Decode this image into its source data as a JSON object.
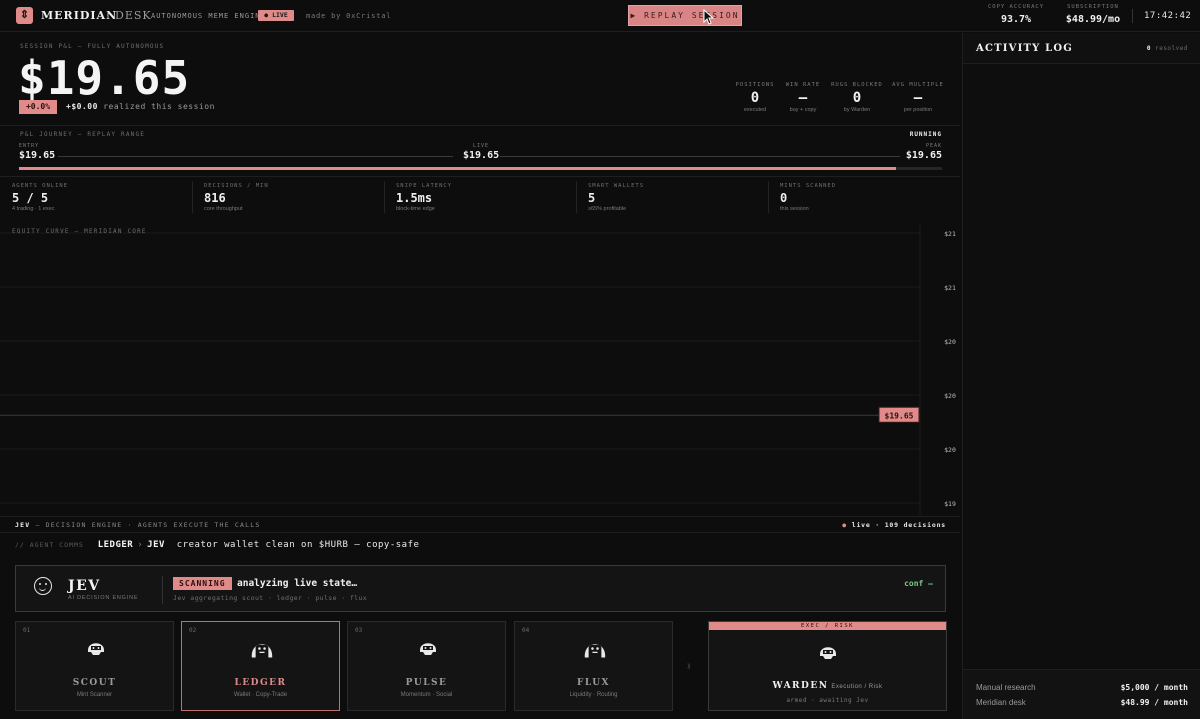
{
  "header": {
    "logo_glyph": "⇕",
    "brand": "MERIDIAN",
    "brand_sub": "· DESK",
    "tagline": "AUTONOMOUS MEME ENGINE",
    "live_label": "● LIVE",
    "made_by": "made by 0xCristal",
    "replay_button": "▶ REPLAY SESSION",
    "copy_accuracy_label": "COPY ACCURACY",
    "copy_accuracy": "93.7%",
    "subscription_label": "SUBSCRIPTION",
    "subscription": "$48.99/mo",
    "clock": "17:42:42"
  },
  "pnl": {
    "label": "SESSION P&L — FULLY AUTONOMOUS",
    "value": "$19.65",
    "pct": "+0.0%",
    "realized_amount": "+$0.00",
    "realized_text": "realized this session",
    "kpis": [
      {
        "label": "POSITIONS",
        "value": "0",
        "sub": "executed"
      },
      {
        "label": "WIN RATE",
        "value": "—",
        "sub": "buy + copy"
      },
      {
        "label": "RUGS BLOCKED",
        "value": "0",
        "sub": "by Warden"
      },
      {
        "label": "AVG MULTIPLE",
        "value": "—",
        "sub": "per position"
      }
    ]
  },
  "journey": {
    "label": "P&L JOURNEY — REPLAY RANGE",
    "status": "RUNNING",
    "entry_label": "ENTRY",
    "entry": "$19.65",
    "live_label": "LIVE",
    "live": "$19.65",
    "peak_label": "PEAK",
    "peak": "$19.65",
    "progress": 0.95
  },
  "stats": [
    {
      "label": "AGENTS ONLINE",
      "value": "5 / 5",
      "sub": "4 trading · 1 exec"
    },
    {
      "label": "DECISIONS / MIN",
      "value": "816",
      "sub": "core throughput"
    },
    {
      "label": "SNIPE LATENCY",
      "value": "1.5ms",
      "sub": "block-time edge"
    },
    {
      "label": "SMART WALLETS",
      "value": "5",
      "sub": "≥65% profitable"
    },
    {
      "label": "MINTS SCANNED",
      "value": "0",
      "sub": "this session"
    }
  ],
  "chart_data": {
    "type": "line",
    "title": "EQUITY CURVE — MERIDIAN CORE",
    "y_ticks": [
      "$21",
      "$21",
      "$20",
      "$20",
      "$20",
      "$19"
    ],
    "current_value_label": "$19.65",
    "current_value": 19.65,
    "ylim": [
      19,
      21
    ],
    "grid": true,
    "series": []
  },
  "engine": {
    "name": "JEV",
    "title_rest": " — DECISION ENGINE · AGENTS EXECUTE THE CALLS",
    "live_dot": "●",
    "live_text": " live · 109 decisions"
  },
  "comms": {
    "label": "// AGENT COMMS",
    "from": "LEDGER",
    "arrow": "›",
    "to": "JEV",
    "message": "creator wallet clean on $HURB — copy-safe"
  },
  "jev": {
    "name": "JEV",
    "role": "AI DECISION ENGINE",
    "status": "SCANNING",
    "message": "analyzing live state…",
    "detail": "Jev aggregating scout · ledger · pulse · flux",
    "conf": "conf —"
  },
  "agents": [
    {
      "num": "01",
      "name": "SCOUT",
      "role": "Mint Scanner",
      "icon": "helmet-avatar-icon"
    },
    {
      "num": "02",
      "name": "LEDGER",
      "role": "Wallet · Copy-Trade",
      "icon": "longhair-avatar-icon"
    },
    {
      "num": "03",
      "name": "PULSE",
      "role": "Momentum · Social",
      "icon": "helmet-avatar-icon"
    },
    {
      "num": "04",
      "name": "FLUX",
      "role": "Liquidity · Routing",
      "icon": "longhair-avatar-icon"
    }
  ],
  "arrow_sep": "⟫",
  "warden": {
    "header": "EXEC / RISK",
    "name": "WARDEN",
    "role": "Execution / Risk",
    "status": "armed · awaiting Jev"
  },
  "sidebar": {
    "title": "ACTIVITY LOG",
    "resolved_count": "0",
    "resolved_label": "resolved",
    "footer": [
      {
        "label": "Manual research",
        "value": "$5,000 / month"
      },
      {
        "label": "Meridian desk",
        "value": "$48.99 / month"
      }
    ]
  },
  "colors": {
    "accent": "#e08a8a",
    "background": "#0d0d0d",
    "positive": "#7bc98a"
  }
}
